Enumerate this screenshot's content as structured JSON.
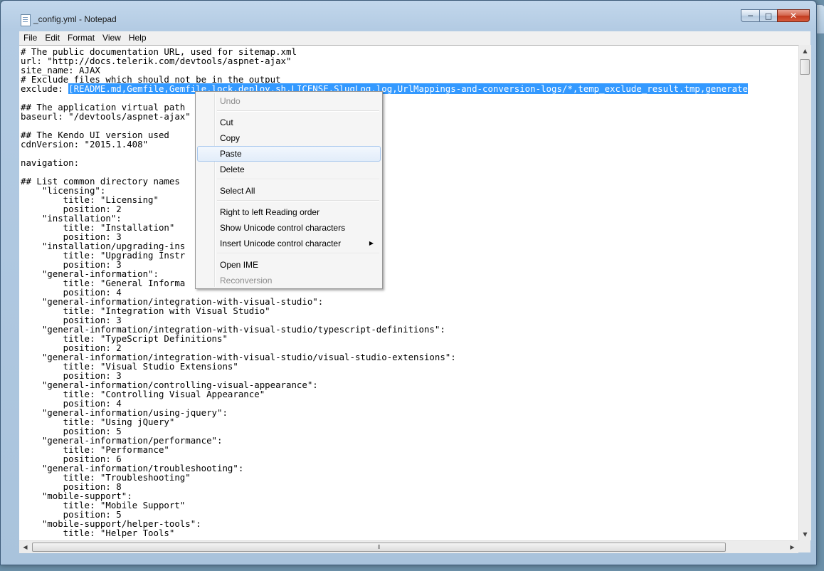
{
  "window": {
    "title": "_config.yml - Notepad",
    "controls": {
      "minimize": "─",
      "maximize": "□",
      "close": "✕"
    }
  },
  "menubar": [
    "File",
    "Edit",
    "Format",
    "View",
    "Help"
  ],
  "editor": {
    "lines": [
      "# The public documentation URL, used for sitemap.xml",
      "url: \"http://docs.telerik.com/devtools/aspnet-ajax\"",
      "site_name: AJAX",
      "# Exclude files which should not be in the output",
      "__EXCLUDE__",
      "",
      "## The application virtual path",
      "baseurl: \"/devtools/aspnet-ajax\"",
      "",
      "## The Kendo UI version used",
      "cdnVersion: \"2015.1.408\"",
      "",
      "navigation:",
      "",
      "## List common directory names",
      "    \"licensing\":",
      "        title: \"Licensing\"",
      "        position: 2",
      "    \"installation\":",
      "        title: \"Installation\"",
      "        position: 3",
      "    \"installation/upgrading-ins",
      "        title: \"Upgrading Instr",
      "        position: 3",
      "    \"general-information\":",
      "        title: \"General Informa",
      "        position: 4",
      "    \"general-information/integration-with-visual-studio\":",
      "        title: \"Integration with Visual Studio\"",
      "        position: 3",
      "    \"general-information/integration-with-visual-studio/typescript-definitions\":",
      "        title: \"TypeScript Definitions\"",
      "        position: 2",
      "    \"general-information/integration-with-visual-studio/visual-studio-extensions\":",
      "        title: \"Visual Studio Extensions\"",
      "        position: 3",
      "    \"general-information/controlling-visual-appearance\":",
      "        title: \"Controlling Visual Appearance\"",
      "        position: 4",
      "    \"general-information/using-jquery\":",
      "        title: \"Using jQuery\"",
      "        position: 5",
      "    \"general-information/performance\":",
      "        title: \"Performance\"",
      "        position: 6",
      "    \"general-information/troubleshooting\":",
      "        title: \"Troubleshooting\"",
      "        position: 8",
      "    \"mobile-support\":",
      "        title: \"Mobile Support\"",
      "        position: 5",
      "    \"mobile-support/helper-tools\":",
      "        title: \"Helper Tools\""
    ],
    "exclude_prefix": "exclude: ",
    "exclude_selected": "[README.md,Gemfile,Gemfile.lock,deploy.sh,LICENSE,SlugLog.log,UrlMappings-and-conversion-logs/*,temp_exclude_result.tmp,generate"
  },
  "context_menu": {
    "items": [
      {
        "label": "Undo",
        "enabled": false
      },
      {
        "separator": true
      },
      {
        "label": "Cut",
        "enabled": true
      },
      {
        "label": "Copy",
        "enabled": true
      },
      {
        "label": "Paste",
        "enabled": true,
        "hover": true
      },
      {
        "label": "Delete",
        "enabled": true
      },
      {
        "separator": true
      },
      {
        "label": "Select All",
        "enabled": true
      },
      {
        "separator": true
      },
      {
        "label": "Right to left Reading order",
        "enabled": true
      },
      {
        "label": "Show Unicode control characters",
        "enabled": true
      },
      {
        "label": "Insert Unicode control character",
        "enabled": true,
        "submenu": true
      },
      {
        "separator": true
      },
      {
        "label": "Open IME",
        "enabled": true
      },
      {
        "label": "Reconversion",
        "enabled": false
      }
    ]
  },
  "scrollbars": {
    "up_arrow": "▲",
    "down_arrow": "▼",
    "left_arrow": "◀",
    "right_arrow": "▶",
    "grip": "⦀"
  }
}
